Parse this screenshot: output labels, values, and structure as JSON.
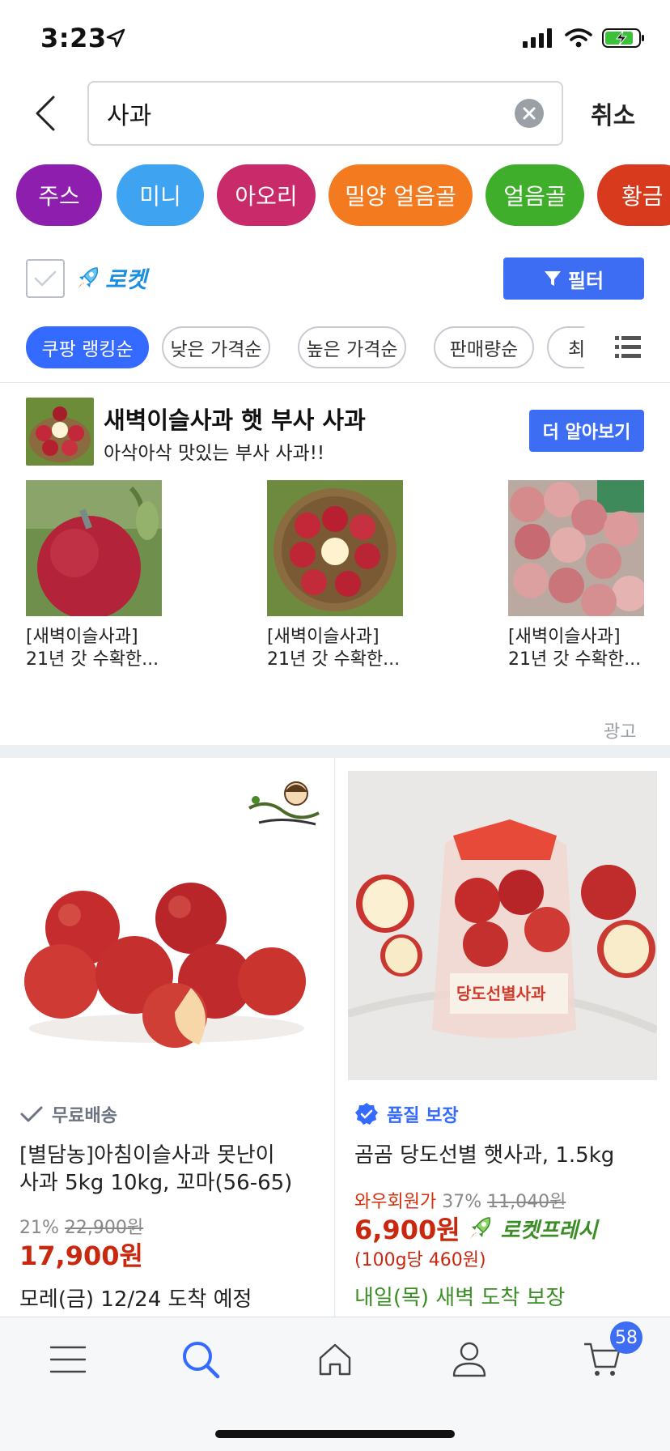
{
  "status_bar": {
    "time": "3:23"
  },
  "search": {
    "query": "사과",
    "cancel_label": "취소"
  },
  "keyword_chips": [
    {
      "label": "주스",
      "color": "#8e1fae"
    },
    {
      "label": "미니",
      "color": "#3ea3f0"
    },
    {
      "label": "아오리",
      "color": "#c92a6a"
    },
    {
      "label": "밀양 얼음골",
      "color": "#f47a20"
    },
    {
      "label": "얼음골",
      "color": "#3fae2a"
    },
    {
      "label": "황금",
      "color": "#d83a1e"
    }
  ],
  "rocket": {
    "label": "로켓",
    "filter_label": "필터"
  },
  "sort_options": [
    {
      "label": "쿠팡 랭킹순",
      "active": true
    },
    {
      "label": "낮은 가격순",
      "active": false
    },
    {
      "label": "높은 가격순",
      "active": false
    },
    {
      "label": "판매량순",
      "active": false
    },
    {
      "label": "최",
      "active": false
    }
  ],
  "ad": {
    "title": "새벽이슬사과 햇 부사 사과",
    "subtitle": "아삭아삭 맛있는 부사 사과!!",
    "cta_label": "더 알아보기",
    "ad_label": "광고",
    "items": [
      {
        "line1": "[새벽이슬사과]",
        "line2": "21년 갓 수확한..."
      },
      {
        "line1": "[새벽이슬사과]",
        "line2": "21년 갓 수확한..."
      },
      {
        "line1": "[새벽이슬사과]",
        "line2": "21년 갓 수확한..."
      }
    ]
  },
  "products": [
    {
      "badge": "무료배송",
      "title_line1": "[별담농]아침이슬사과 못난이",
      "title_line2": "사과 5kg 10kg, 꼬마(56-65)",
      "discount": "21%",
      "original_price": "22,900원",
      "sale_price": "17,900원",
      "arrival": "모레(금) 12/24 도착 예정"
    },
    {
      "badge": "품질 보장",
      "title": "곰곰 당도선별 햇사과, 1.5kg",
      "wow_label": "와우회원가",
      "discount": "37%",
      "original_price": "11,040원",
      "sale_price": "6,900원",
      "rocket_fresh": "로켓프레시",
      "unit_price": "(100g당 460원)",
      "arrival": "내일(목) 새벽 도착 보장",
      "package_text": "당도선별사과"
    }
  ],
  "nav": {
    "cart_count": "58"
  },
  "colors": {
    "accent": "#346aff",
    "price_red": "#c9280f",
    "green": "#3a8e25"
  }
}
